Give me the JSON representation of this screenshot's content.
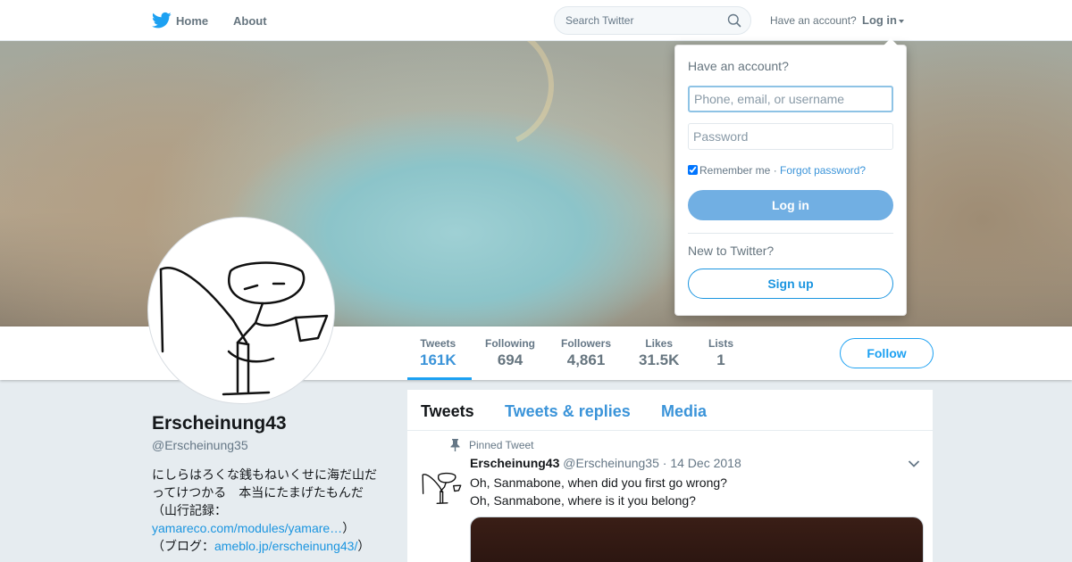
{
  "topnav": {
    "logo_icon": "twitter-bird-icon",
    "home_label": "Home",
    "about_label": "About",
    "search_placeholder": "Search Twitter",
    "have_account_text": "Have an account?",
    "login_label": "Log in"
  },
  "login_dropdown": {
    "title": "Have an account?",
    "username_placeholder": "Phone, email, or username",
    "password_placeholder": "Password",
    "remember_label": "Remember me",
    "separator": "·",
    "forgot_label": "Forgot password?",
    "remember_checked": true,
    "login_button": "Log in",
    "new_text": "New to Twitter?",
    "signup_button": "Sign up"
  },
  "profile_nav": {
    "stats": [
      {
        "label": "Tweets",
        "value": "161K",
        "active": true
      },
      {
        "label": "Following",
        "value": "694"
      },
      {
        "label": "Followers",
        "value": "4,861"
      },
      {
        "label": "Likes",
        "value": "31.5K"
      },
      {
        "label": "Lists",
        "value": "1"
      }
    ],
    "follow_button": "Follow"
  },
  "profile": {
    "name": "Erscheinung43",
    "handle": "@Erscheinung35",
    "bio_line1": "にしらはろくな銭もねいくせに海だ山だってけつかる　本当にたまげたもんだ",
    "bio_line2_pre": "（山行記録：",
    "bio_link1": "yamareco.com/modules/yamare…",
    "bio_line2_post": "）",
    "bio_line3_pre": "（ブログ：",
    "bio_link2": "ameblo.jp/erscheinung43/",
    "bio_line3_post": "）"
  },
  "timeline": {
    "tabs": [
      {
        "label": "Tweets",
        "active": true
      },
      {
        "label": "Tweets & replies"
      },
      {
        "label": "Media"
      }
    ],
    "pinned_label": "Pinned Tweet",
    "tweet": {
      "fullname": "Erscheinung43",
      "handle": "@Erscheinung35",
      "dot": "·",
      "date": "14 Dec 2018",
      "line1": "Oh, Sanmabone, when did you first go wrong?",
      "line2": "Oh, Sanmabone, where is it you belong?"
    }
  },
  "colors": {
    "accent": "#1da1f2",
    "link": "#1b95e0",
    "login_button_bg": "#71afe3",
    "muted_text": "#657786"
  }
}
